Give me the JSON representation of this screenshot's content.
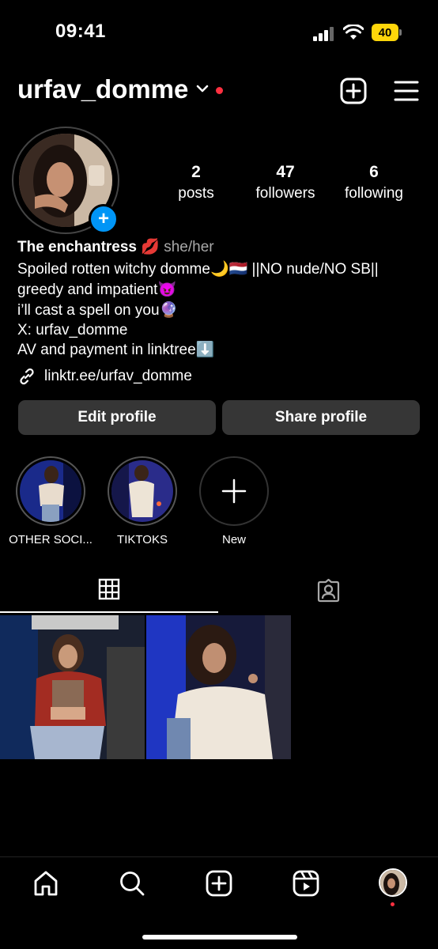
{
  "status_bar": {
    "time": "09:41",
    "battery": "40"
  },
  "header": {
    "username": "urfav_domme"
  },
  "stats": [
    {
      "value": "2",
      "label": "posts"
    },
    {
      "value": "47",
      "label": "followers"
    },
    {
      "value": "6",
      "label": "following"
    }
  ],
  "bio": {
    "name": "The enchantress 💋",
    "pronouns": "she/her",
    "lines": [
      "Spoiled rotten witchy domme🌙🇳🇱 ||NO nude/NO SB||",
      "greedy and impatient😈",
      "i’ll cast a spell on you🔮",
      "X: urfav_domme",
      "AV and payment in linktree⬇️"
    ],
    "link": "linktr.ee/urfav_domme"
  },
  "buttons": {
    "edit": "Edit profile",
    "share": "Share profile"
  },
  "highlights": [
    {
      "label": "OTHER SOCI..."
    },
    {
      "label": "TIKTOKS"
    },
    {
      "label": "New"
    }
  ],
  "tabs": [
    "grid-icon",
    "tagged-icon"
  ],
  "nav": [
    "home-icon",
    "search-icon",
    "create-icon",
    "reels-icon",
    "profile-avatar"
  ],
  "colors": {
    "accent": "#0095f6",
    "notification": "#ff3040",
    "button_bg": "#363636"
  }
}
